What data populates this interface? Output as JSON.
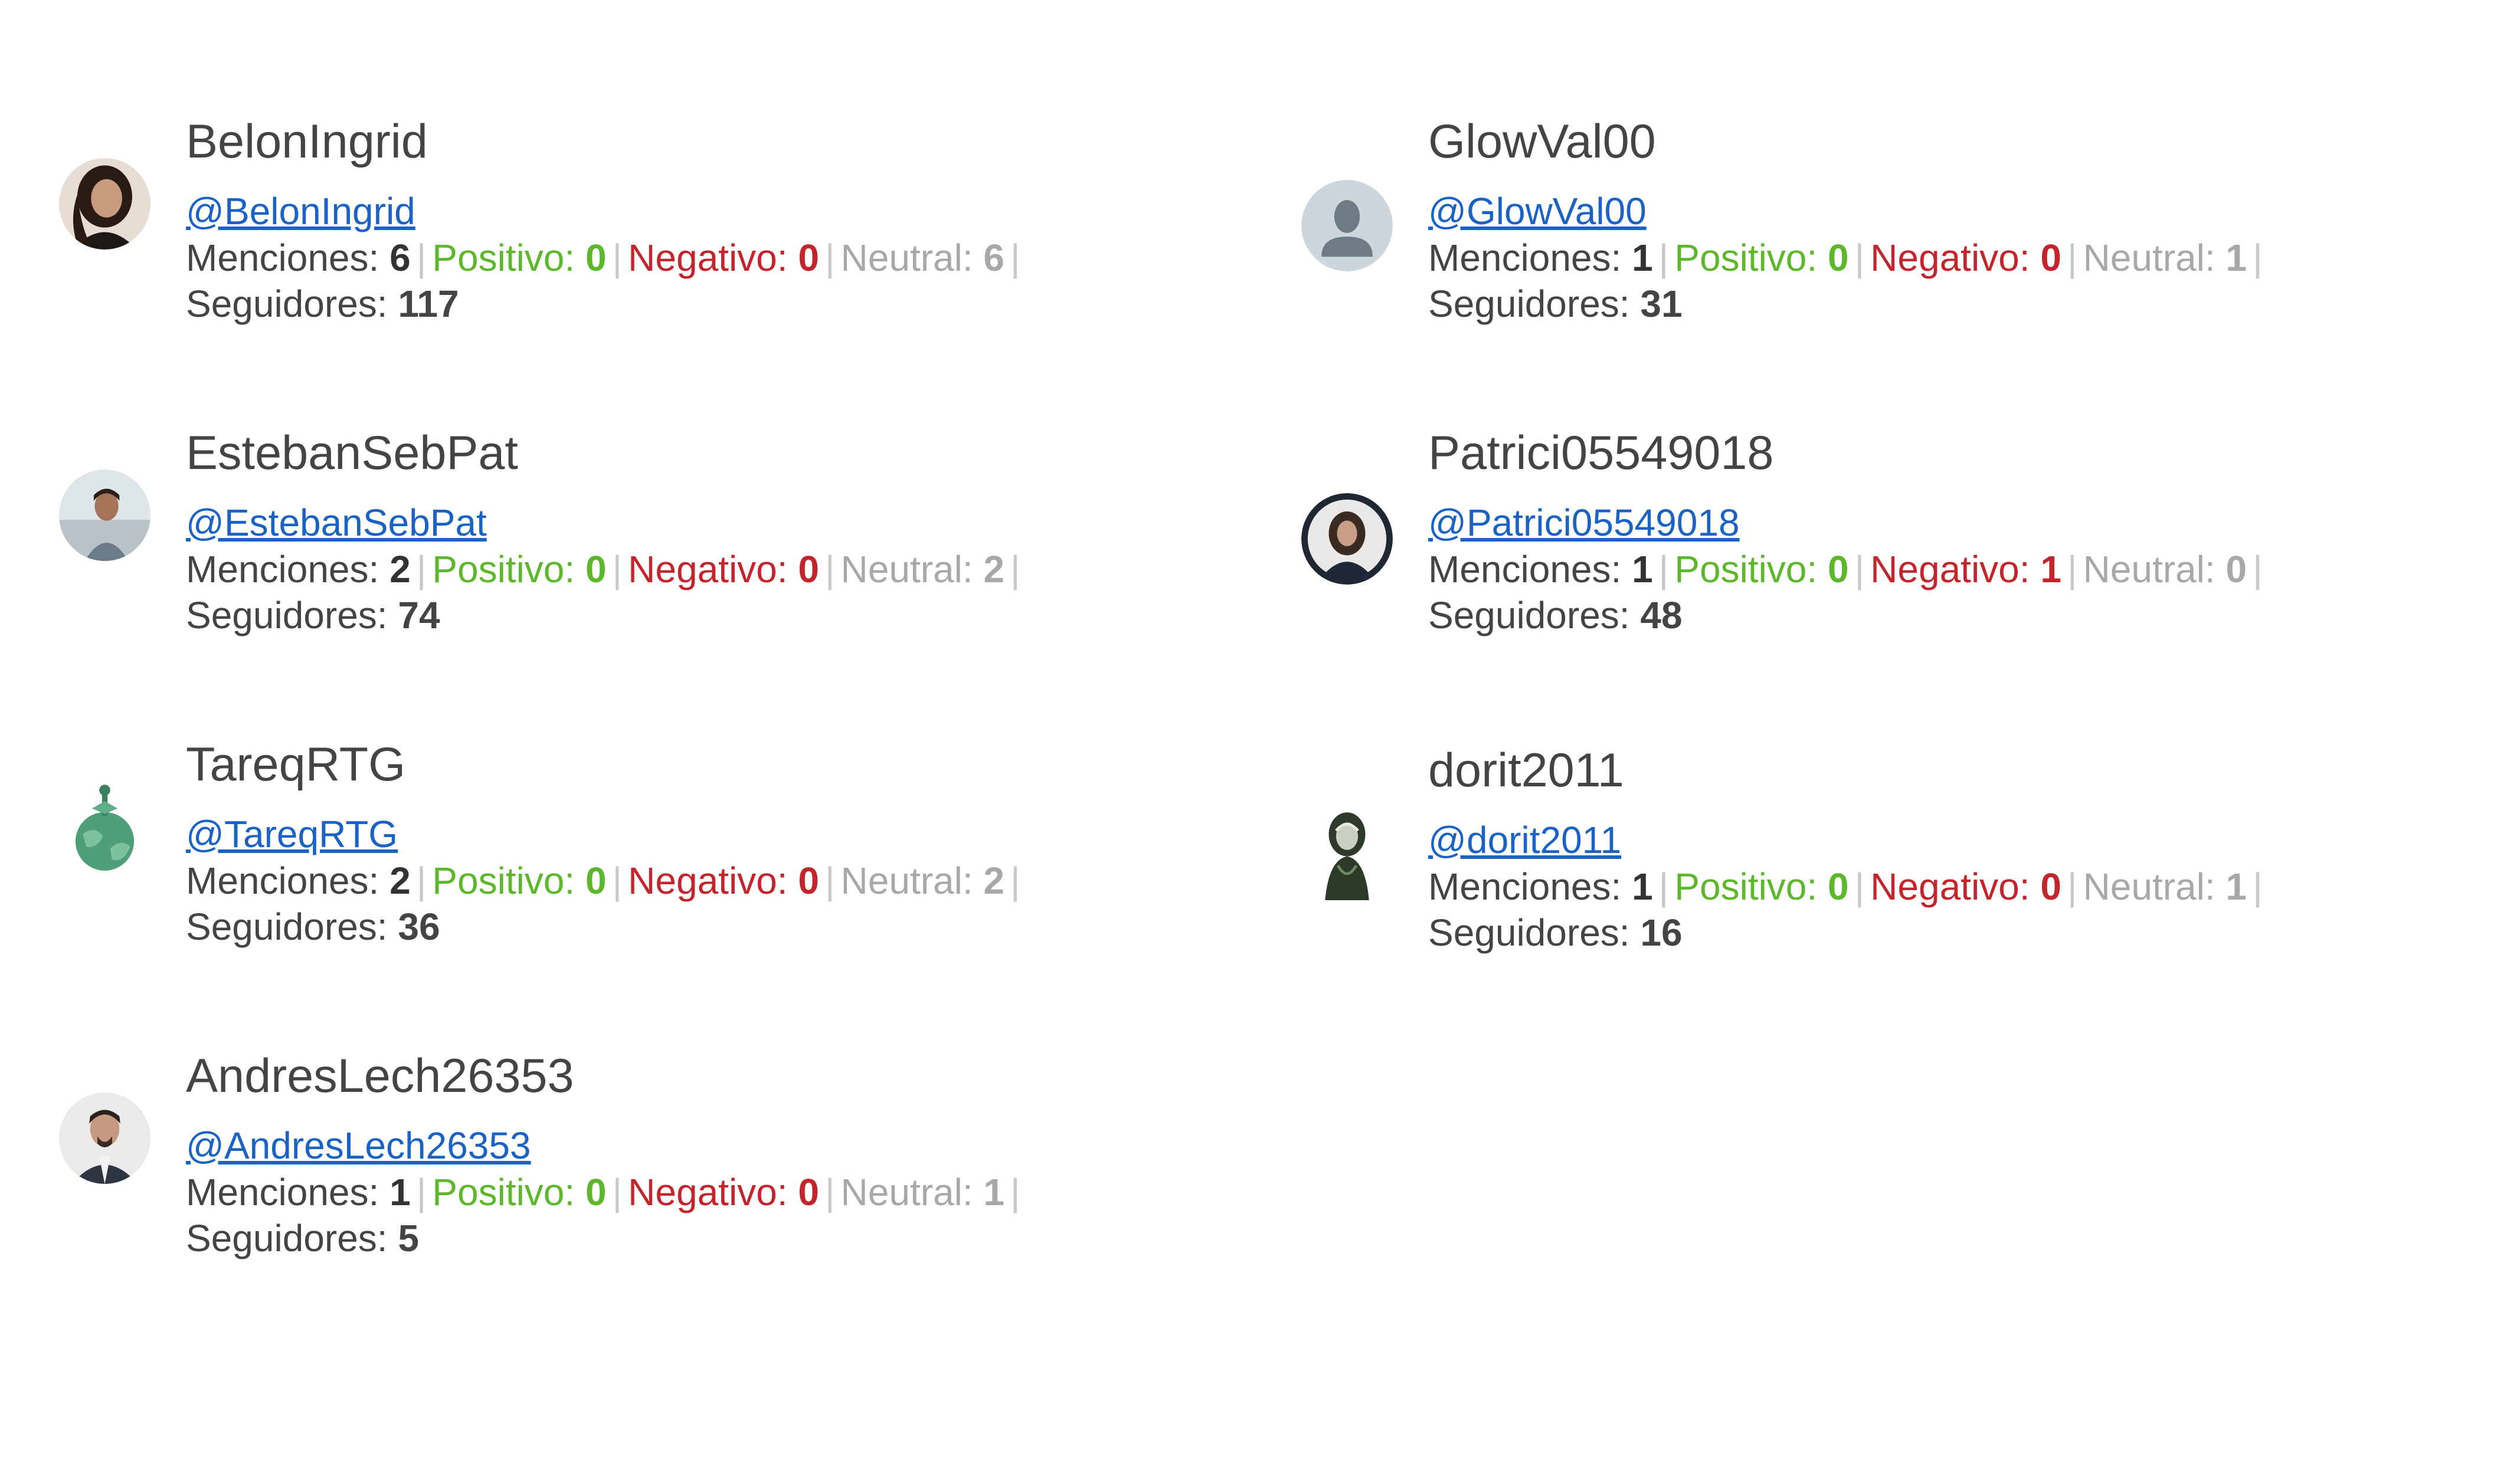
{
  "labels": {
    "mentions": "Menciones:",
    "positive": "Positivo:",
    "negative": "Negativo:",
    "neutral": "Neutral:",
    "followers": "Seguidores:",
    "separator": "|"
  },
  "colors": {
    "link": "#1a63c4",
    "positive": "#5cb82a",
    "negative": "#c4252d",
    "neutral": "#a8a8a8",
    "text": "#444444"
  },
  "users": [
    {
      "name": "BelonIngrid",
      "handle": "@BelonIngrid",
      "mentions": "6",
      "positive": "0",
      "negative": "0",
      "neutral": "6",
      "followers": "117",
      "avatar_icon": "woman-photo-avatar-icon"
    },
    {
      "name": "EstebanSebPat",
      "handle": "@EstebanSebPat",
      "mentions": "2",
      "positive": "0",
      "negative": "0",
      "neutral": "2",
      "followers": "74",
      "avatar_icon": "man-photo-avatar-icon"
    },
    {
      "name": "TareqRTG",
      "handle": "@TareqRTG",
      "mentions": "2",
      "positive": "0",
      "negative": "0",
      "neutral": "2",
      "followers": "36",
      "avatar_icon": "globe-avatar-icon"
    },
    {
      "name": "AndresLech26353",
      "handle": "@AndresLech26353",
      "mentions": "1",
      "positive": "0",
      "negative": "0",
      "neutral": "1",
      "followers": "5",
      "avatar_icon": "man-suit-avatar-icon"
    },
    {
      "name": "GlowVal00",
      "handle": "@GlowVal00",
      "mentions": "1",
      "positive": "0",
      "negative": "0",
      "neutral": "1",
      "followers": "31",
      "avatar_icon": "default-user-avatar-icon"
    },
    {
      "name": "Patrici05549018",
      "handle": "@Patrici05549018",
      "mentions": "1",
      "positive": "0",
      "negative": "1",
      "neutral": "0",
      "followers": "48",
      "avatar_icon": "woman-photo-avatar-icon"
    },
    {
      "name": "dorit2011",
      "handle": "@dorit2011",
      "mentions": "1",
      "positive": "0",
      "negative": "0",
      "neutral": "1",
      "followers": "16",
      "avatar_icon": "statue-avatar-icon"
    }
  ]
}
